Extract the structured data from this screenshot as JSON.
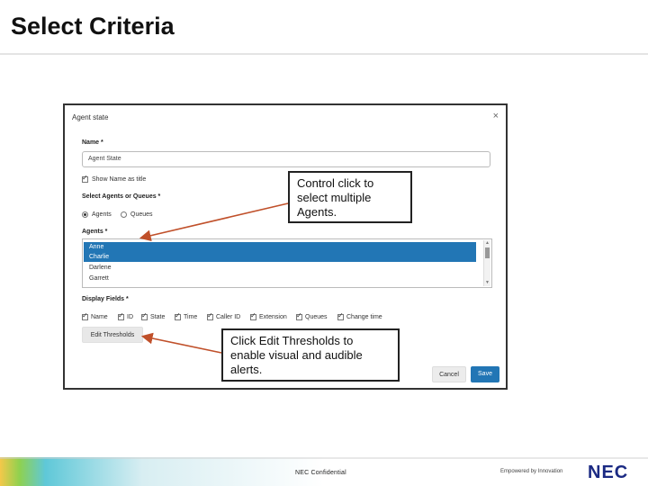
{
  "slide": {
    "title": "Select Criteria"
  },
  "dialog": {
    "title": "Agent state",
    "close_glyph": "×",
    "name_label": "Name *",
    "name_value": "Agent State",
    "show_name_label": "Show Name as title",
    "show_name_checked": true,
    "select_label": "Select Agents or Queues *",
    "radio_agents": "Agents",
    "radio_queues": "Queues",
    "selected_radio": "Agents",
    "agents_label": "Agents *",
    "agents": [
      {
        "name": "Anne",
        "selected": true
      },
      {
        "name": "Charlie",
        "selected": true
      },
      {
        "name": "Darlene",
        "selected": false
      },
      {
        "name": "Garrett",
        "selected": false
      }
    ],
    "display_fields_label": "Display Fields *",
    "fields": [
      "Name",
      "ID",
      "State",
      "Time",
      "Caller ID",
      "Extension",
      "Queues",
      "Change time"
    ],
    "edit_thresholds_label": "Edit Thresholds",
    "cancel_label": "Cancel",
    "save_label": "Save"
  },
  "callouts": {
    "one": [
      "Control click to",
      "select multiple",
      "Agents."
    ],
    "two": [
      "Click Edit Thresholds to",
      "enable visual and audible",
      "alerts."
    ]
  },
  "footer": {
    "confidential": "NEC Confidential",
    "tagline": "Empowered by Innovation",
    "logo": "NEC"
  },
  "colors": {
    "accent": "#2276b5",
    "arrow": "#c0502a",
    "logo": "#1b2a83"
  }
}
